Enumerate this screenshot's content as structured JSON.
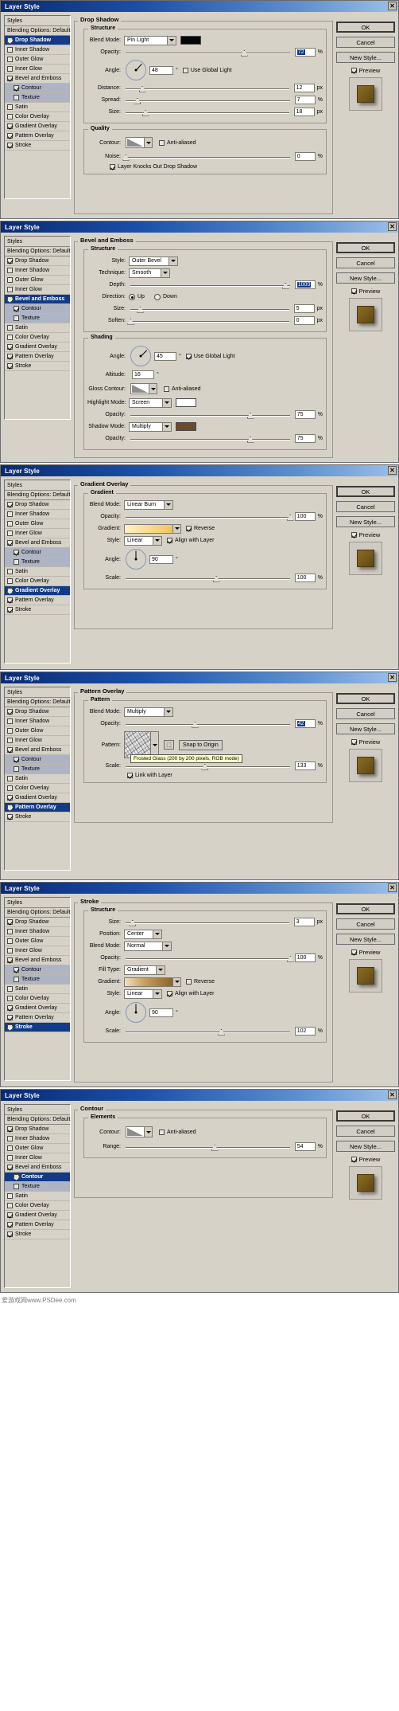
{
  "window": {
    "title": "Layer Style",
    "close_label": "✕"
  },
  "buttons": {
    "ok": "OK",
    "cancel": "Cancel",
    "new_style": "New Style...",
    "preview": "Preview"
  },
  "styles_list": {
    "header": "Styles",
    "blending": "Blending Options: Default",
    "items": [
      {
        "label": "Drop Shadow",
        "checked": true
      },
      {
        "label": "Inner Shadow",
        "checked": false
      },
      {
        "label": "Outer Glow",
        "checked": false
      },
      {
        "label": "Inner Glow",
        "checked": false
      },
      {
        "label": "Bevel and Emboss",
        "checked": true
      },
      {
        "label": "Contour",
        "checked": true,
        "sub": true
      },
      {
        "label": "Texture",
        "checked": false,
        "sub": true
      },
      {
        "label": "Satin",
        "checked": false
      },
      {
        "label": "Color Overlay",
        "checked": false
      },
      {
        "label": "Gradient Overlay",
        "checked": true
      },
      {
        "label": "Pattern Overlay",
        "checked": true
      },
      {
        "label": "Stroke",
        "checked": true
      }
    ]
  },
  "panels": [
    {
      "id": "drop-shadow",
      "selected": "Drop Shadow",
      "group_label": "Drop Shadow",
      "sub_label": "Structure",
      "blend_mode_label": "Blend Mode:",
      "blend_mode": "Pin Light",
      "color_hex": "#050505",
      "opacity_label": "Opacity:",
      "opacity": "72",
      "opacity_pct": 72,
      "angle_label": "Angle:",
      "angle": "48",
      "use_global_light": "Use Global Light",
      "use_global_light_on": false,
      "distance_label": "Distance:",
      "distance": "12",
      "distance_pct": 10,
      "spread_label": "Spread:",
      "spread": "7",
      "spread_pct": 7,
      "size_label": "Size:",
      "size": "18",
      "size_pct": 12,
      "quality_label": "Quality",
      "contour_label": "Contour:",
      "anti_aliased": "Anti-aliased",
      "anti_aliased_on": false,
      "noise_label": "Noise:",
      "noise": "0",
      "noise_pct": 0,
      "knockout_label": "Layer Knocks Out Drop Shadow",
      "knockout_on": true,
      "unit_pct": "%",
      "unit_px": "px",
      "unit_deg": "°"
    },
    {
      "id": "bevel-emboss",
      "selected": "Bevel and Emboss",
      "group_label": "Bevel and Emboss",
      "sub_label": "Structure",
      "style_label": "Style:",
      "style": "Outer Bevel",
      "technique_label": "Technique:",
      "technique": "Smooth",
      "depth_label": "Depth:",
      "depth": "1000",
      "depth_pct": 97,
      "direction_label": "Direction:",
      "dir_up": "Up",
      "dir_down": "Down",
      "direction": "Up",
      "size_label": "Size:",
      "size": "5",
      "size_pct": 6,
      "soften_label": "Soften:",
      "soften": "0",
      "soften_pct": 0,
      "shading_label": "Shading",
      "angle_label": "Angle:",
      "angle": "45",
      "use_global_light": "Use Global Light",
      "use_global_light_on": true,
      "altitude_label": "Altitude:",
      "altitude": "16",
      "gloss_label": "Gloss Contour:",
      "anti_aliased": "Anti-aliased",
      "anti_aliased_on": false,
      "highlight_label": "Highlight Mode:",
      "highlight_mode": "Screen",
      "highlight_color": "#ffffff",
      "highlight_opacity_label": "Opacity:",
      "highlight_opacity": "75",
      "highlight_opacity_pct": 75,
      "shadow_label": "Shadow Mode:",
      "shadow_mode": "Multiply",
      "shadow_color": "#6b4a2e",
      "shadow_opacity_label": "Opacity:",
      "shadow_opacity": "75",
      "shadow_opacity_pct": 75,
      "unit_pct": "%",
      "unit_px": "px",
      "unit_deg": "°"
    },
    {
      "id": "gradient-overlay",
      "selected": "Gradient Overlay",
      "group_label": "Gradient Overlay",
      "sub_label": "Gradient",
      "blend_mode_label": "Blend Mode:",
      "blend_mode": "Linear Burn",
      "opacity_label": "Opacity:",
      "opacity": "100",
      "opacity_pct": 100,
      "gradient_label": "Gradient:",
      "gradient_css": "linear-gradient(to right, #fdf1c8 0%, #f7d98c 55%, #f2c45a 100%)",
      "reverse_label": "Reverse",
      "reverse_on": true,
      "style_label": "Style:",
      "style": "Linear",
      "align_label": "Align with Layer",
      "align_on": true,
      "angle_label": "Angle:",
      "angle": "90",
      "scale_label": "Scale:",
      "scale": "100",
      "scale_pct": 55,
      "unit_pct": "%",
      "unit_deg": "°"
    },
    {
      "id": "pattern-overlay",
      "selected": "Pattern Overlay",
      "group_label": "Pattern Overlay",
      "sub_label": "Pattern",
      "blend_mode_label": "Blend Mode:",
      "blend_mode": "Multiply",
      "opacity_label": "Opacity:",
      "opacity": "42",
      "opacity_pct": 42,
      "pattern_label": "Pattern:",
      "snap_label": "Snap to Origin",
      "tooltip": "Frosted Glass (200 by 200 pixels, RGB mode)",
      "scale_label": "Scale:",
      "scale": "133",
      "scale_pct": 48,
      "link_label": "Link with Layer",
      "link_on": true,
      "unit_pct": "%"
    },
    {
      "id": "stroke",
      "selected": "Stroke",
      "group_label": "Stroke",
      "sub_label": "Structure",
      "size_label": "Size:",
      "size": "3",
      "size_pct": 4,
      "position_label": "Position:",
      "position": "Center",
      "blend_mode_label": "Blend Mode:",
      "blend_mode": "Normal",
      "opacity_label": "Opacity:",
      "opacity": "100",
      "opacity_pct": 100,
      "fill_type_label": "Fill Type:",
      "fill_type": "Gradient",
      "gradient_label": "Gradient:",
      "gradient_css": "linear-gradient(to right, #f0e0bf 0%, #c9a062 40%, #8d6428 100%)",
      "reverse_label": "Reverse",
      "reverse_on": false,
      "style_label": "Style:",
      "style": "Linear",
      "align_label": "Align with Layer",
      "align_on": true,
      "angle_label": "Angle:",
      "angle": "90",
      "scale_label": "Scale:",
      "scale": "102",
      "scale_pct": 58,
      "unit_pct": "%",
      "unit_px": "px",
      "unit_deg": "°"
    },
    {
      "id": "contour",
      "selected": "Contour",
      "group_label": "Contour",
      "sub_label": "Elements",
      "contour_label": "Contour:",
      "anti_aliased": "Anti-aliased",
      "anti_aliased_on": false,
      "range_label": "Range:",
      "range": "54",
      "range_pct": 54,
      "unit_pct": "%"
    }
  ],
  "watermark": "爱游戏网www.PSDee.com"
}
